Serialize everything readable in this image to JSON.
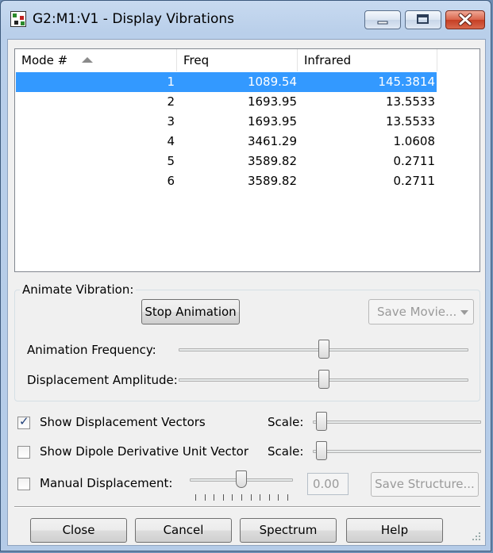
{
  "window": {
    "title": "G2:M1:V1 - Display Vibrations"
  },
  "table": {
    "columns": [
      "Mode #",
      "Freq",
      "Infrared"
    ],
    "rows": [
      {
        "mode": "1",
        "freq": "1089.54",
        "ir": "145.3814"
      },
      {
        "mode": "2",
        "freq": "1693.95",
        "ir": "13.5533"
      },
      {
        "mode": "3",
        "freq": "1693.95",
        "ir": "13.5533"
      },
      {
        "mode": "4",
        "freq": "3461.29",
        "ir": "1.0608"
      },
      {
        "mode": "5",
        "freq": "3589.82",
        "ir": "0.2711"
      },
      {
        "mode": "6",
        "freq": "3589.82",
        "ir": "0.2711"
      }
    ],
    "selected_row": 1
  },
  "animate": {
    "group_label": "Animate Vibration:",
    "stop_button": "Stop Animation",
    "save_movie": "Save Movie...",
    "frequency_label": "Animation Frequency:",
    "amplitude_label": "Displacement Amplitude:",
    "frequency_level": 0.5,
    "amplitude_level": 0.5
  },
  "options": {
    "show_vectors": {
      "label": "Show Displacement Vectors",
      "checked": true,
      "scale_label": "Scale:",
      "scale_level": 0.05
    },
    "show_dipole": {
      "label": "Show Dipole Derivative Unit Vector",
      "checked": false,
      "scale_label": "Scale:",
      "scale_level": 0.05
    },
    "manual": {
      "label": "Manual Displacement:",
      "checked": false,
      "value": "0.00",
      "save_structure": "Save Structure...",
      "level": 0.5
    }
  },
  "buttons": {
    "close": "Close",
    "cancel": "Cancel",
    "spectrum": "Spectrum",
    "help": "Help"
  },
  "colors": {
    "selection": "#3399ff",
    "titlebar": "#b9cfea",
    "dialog": "#f0f0f0"
  }
}
